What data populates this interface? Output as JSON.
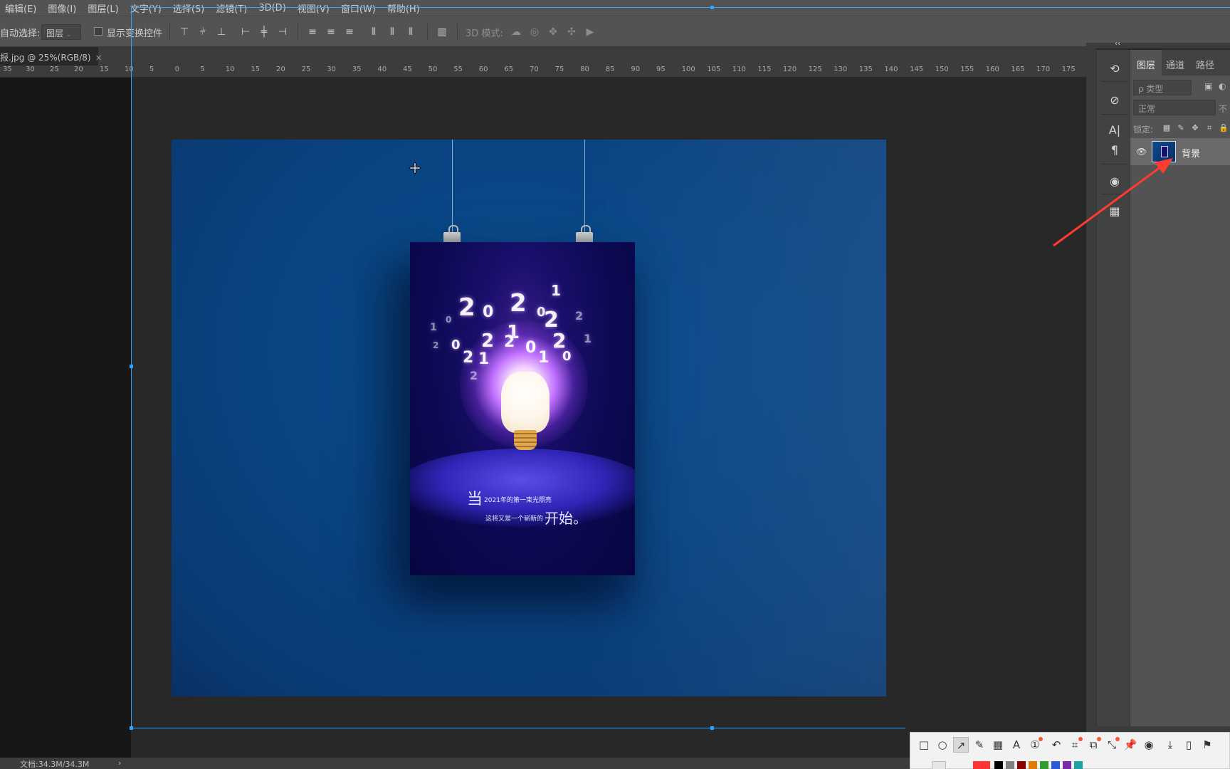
{
  "menu": [
    "编辑(E)",
    "图像(I)",
    "图层(L)",
    "文字(Y)",
    "选择(S)",
    "滤镜(T)",
    "3D(D)",
    "视图(V)",
    "窗口(W)",
    "帮助(H)"
  ],
  "options": {
    "auto_select_label": "自动选择:",
    "auto_select_value": "图层",
    "show_transform_label": "显示变换控件",
    "mode_3d_label": "3D 模式:"
  },
  "document_tab": {
    "title": "报.jpg @ 25%(RGB/8)",
    "close": "×"
  },
  "ruler_left_labels": [
    "35",
    "30",
    "25",
    "20",
    "15",
    "10",
    "5",
    "0"
  ],
  "ruler_labels": [
    "5",
    "0",
    "5",
    "10",
    "15",
    "20",
    "25",
    "30",
    "35",
    "40",
    "45",
    "50",
    "55",
    "60",
    "65",
    "70",
    "75",
    "80",
    "85",
    "90",
    "95",
    "100",
    "105",
    "110",
    "115",
    "120",
    "125",
    "130",
    "135",
    "140",
    "145",
    "150",
    "155",
    "160",
    "165",
    "170",
    "175"
  ],
  "poster": {
    "numbers": [
      "2",
      "0",
      "2",
      "1",
      "0",
      "2",
      "1",
      "2",
      "0",
      "2",
      "1",
      "2",
      "0",
      "1",
      "2",
      "0",
      "2",
      "1",
      "1",
      "2",
      "0",
      "2"
    ],
    "caption_big_1": "当",
    "caption_line_1": "2021年的第一束光照亮",
    "caption_line_2": "这将又是一个崭新的",
    "caption_big_2": "开始。"
  },
  "panel": {
    "collapse": "‹‹",
    "tabs": [
      "图层",
      "通道",
      "路径"
    ],
    "kind_filter": "ρ 类型",
    "blend_mode": "正常",
    "opacity_label": "不",
    "lock_label": "锁定:",
    "layer_name": "背景"
  },
  "status": {
    "doc_size": "文档:34.3M/34.3M",
    "arrow": "›"
  },
  "colors": {
    "guide": "#2ea3ff",
    "annotation_arrow": "#ff3b30",
    "ps_panel": "#535353",
    "canvas_bg": "#282828"
  },
  "snap_swatches": [
    "#ffffff",
    "#ff3333",
    "#000000",
    "#808080",
    "#8b0000",
    "#e07b00",
    "#2e9e2e",
    "#2a5bd7",
    "#7a2aa8",
    "#1aa3a3"
  ]
}
